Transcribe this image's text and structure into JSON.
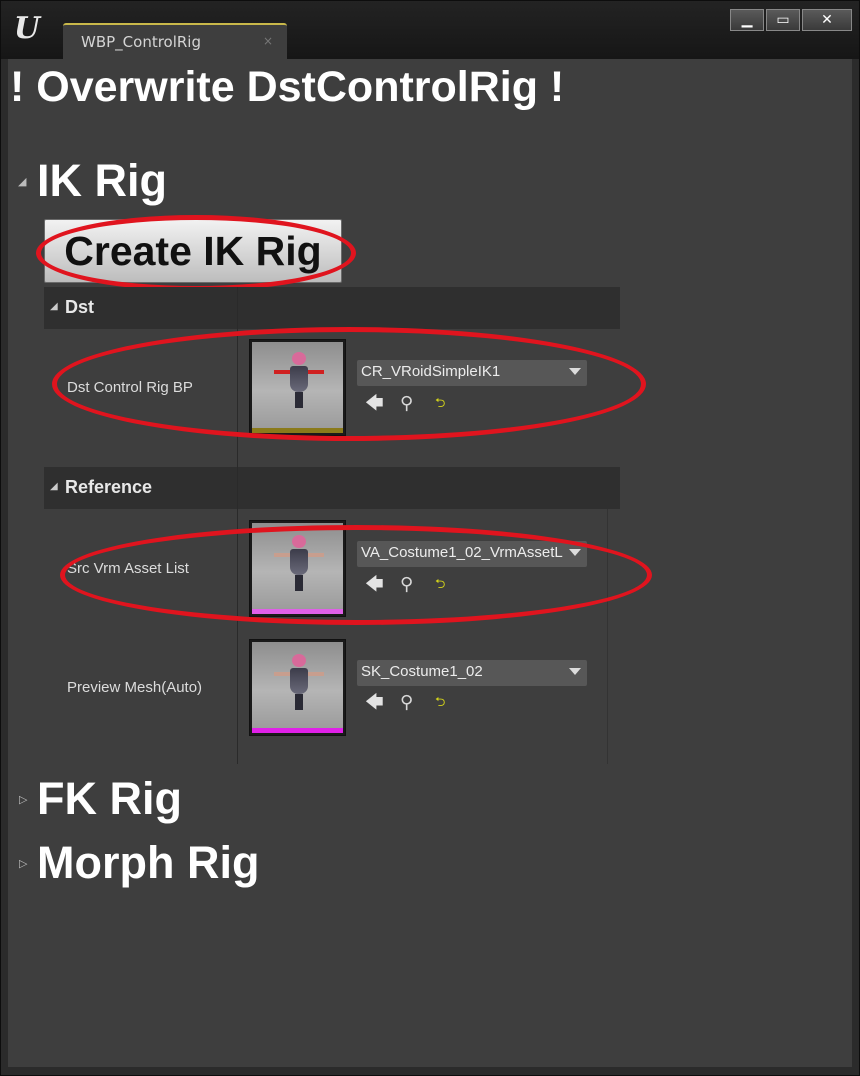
{
  "window": {
    "tab_title": "WBP_ControlRig",
    "tab_close_glyph": "×",
    "buttons": {
      "minimize": "▁",
      "maximize": "▭",
      "close": "✕"
    }
  },
  "warning_title": "! Overwrite DstControlRig !",
  "ik_section": {
    "arrow": "◢",
    "title": "IK Rig",
    "create_button": "Create IK Rig"
  },
  "dst_category": {
    "arrow": "◢",
    "label": "Dst",
    "properties": [
      {
        "label": "Dst Control Rig BP",
        "value": "CR_VRoidSimpleIK1",
        "thumb_bar_color": "#8a7a1a"
      }
    ]
  },
  "reference_category": {
    "arrow": "◢",
    "label": "Reference",
    "properties": [
      {
        "label": "Src Vrm Asset List",
        "value": "VA_Costume1_02_VrmAssetL",
        "thumb_bar_color": "#e060e8"
      },
      {
        "label": "Preview Mesh(Auto)",
        "value": "SK_Costume1_02",
        "thumb_bar_color": "#e020e8"
      }
    ]
  },
  "collapsed_sections": [
    {
      "arrow": "▷",
      "title": "FK Rig"
    },
    {
      "arrow": "▷",
      "title": "Morph Rig"
    }
  ],
  "icons": {
    "logo": "unreal-logo-icon",
    "back": "use-selected-arrow-icon",
    "find": "browse-magnifier-icon",
    "reset": "reset-to-default-icon",
    "dropdown": "chevron-down-icon"
  },
  "glyphs": {
    "ue_logo": "U",
    "back": "🡄",
    "find": "⚲",
    "reset": "⮌"
  },
  "colors": {
    "annotation_red": "#e0141e",
    "panel_bg": "#3e3e3e",
    "tab_accent": "#c9b84a"
  }
}
